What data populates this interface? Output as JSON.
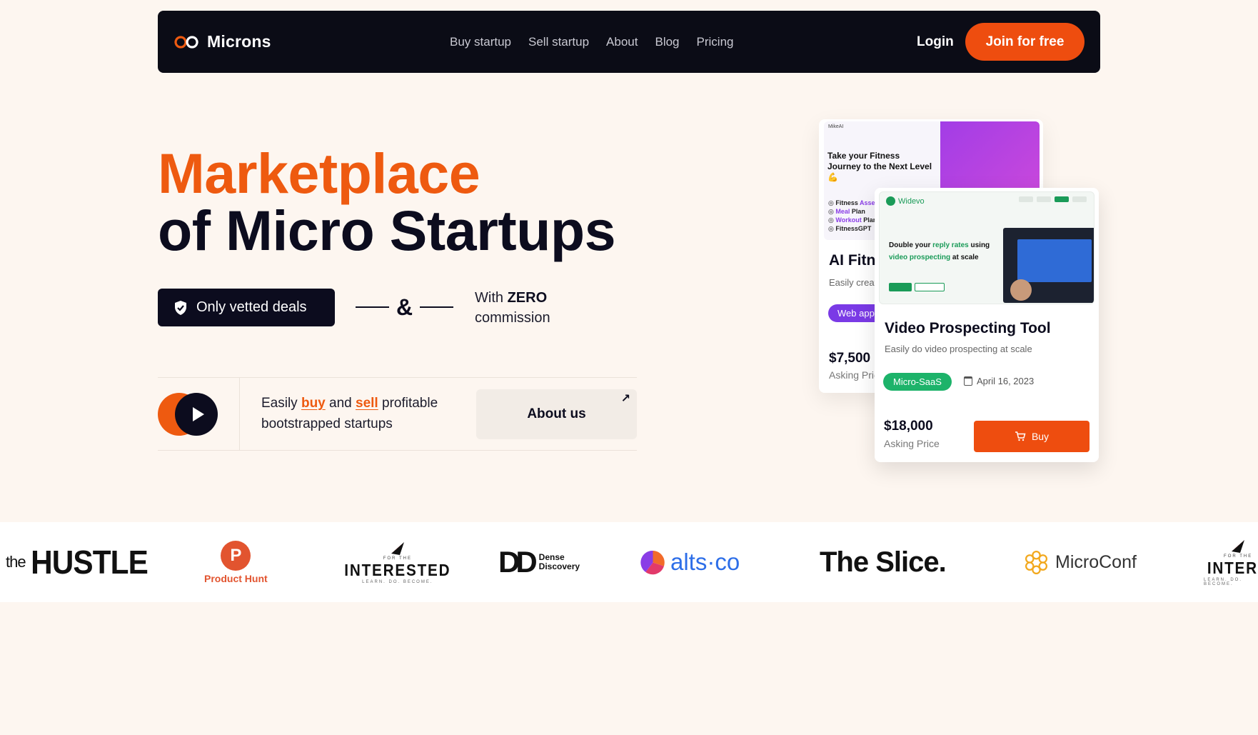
{
  "nav": {
    "brand": "Microns",
    "links": [
      "Buy startup",
      "Sell startup",
      "About",
      "Blog",
      "Pricing"
    ],
    "login": "Login",
    "join": "Join for free"
  },
  "hero": {
    "title_line1": "Marketplace",
    "title_line2": "of Micro Startups",
    "vetted_badge": "Only vetted deals",
    "ampersand": "&",
    "zero_prefix": "With ",
    "zero_bold": "ZERO",
    "zero_suffix": "commission",
    "easily_1": "Easily ",
    "easily_buy": "buy",
    "easily_2": " and ",
    "easily_sell": "sell",
    "easily_3": " profitable bootstrapped startups",
    "about_button": "About us",
    "about_arrow": "↗"
  },
  "cards": {
    "back": {
      "shot_logo": "MikeAI",
      "shot_headline": "Take your Fitness Journey to the Next Level 💪",
      "shot_items": [
        {
          "a": "Fitness ",
          "b": "Assess"
        },
        {
          "a": "Meal ",
          "b": "Plan"
        },
        {
          "a": "Workout ",
          "b": "Plan"
        },
        {
          "a": "FitnessGPT",
          "b": ""
        }
      ],
      "title": "AI Fitn",
      "subtitle": "Easily creat",
      "tag": "Web app",
      "price": "$7,500",
      "asking": "Asking Pric"
    },
    "front": {
      "shot_logo": "Widevo",
      "shot_headline_1": "Double your ",
      "shot_headline_hl1": "reply rates",
      "shot_headline_2": " using ",
      "shot_headline_hl2": "video prospecting",
      "shot_headline_3": " at scale",
      "title": "Video Prospecting Tool",
      "subtitle": "Easily do video prospecting at scale",
      "tag": "Micro-SaaS",
      "date": "April 16, 2023",
      "price": "$18,000",
      "asking": "Asking Price",
      "buy": "Buy"
    }
  },
  "logos": {
    "hustle_the": "the",
    "hustle_big": "HUSTLE",
    "ph_letter": "P",
    "ph_text": "Product Hunt",
    "fti_small": "FOR        THE",
    "fti_big": "INTERESTED",
    "fti_tag": "LEARN. DO. BECOME.",
    "dd_mark": "DD",
    "dd_text_1": "Dense",
    "dd_text_2": "Discovery",
    "alts": "alts·co",
    "slice": "The Slice.",
    "microconf": "MicroConf",
    "fti2_big": "INTERE"
  },
  "colors": {
    "accent": "#ee4d0f",
    "dark": "#0c0c1e",
    "background": "#fdf6f0",
    "green": "#1db36a",
    "purple": "#7a3ae6"
  }
}
